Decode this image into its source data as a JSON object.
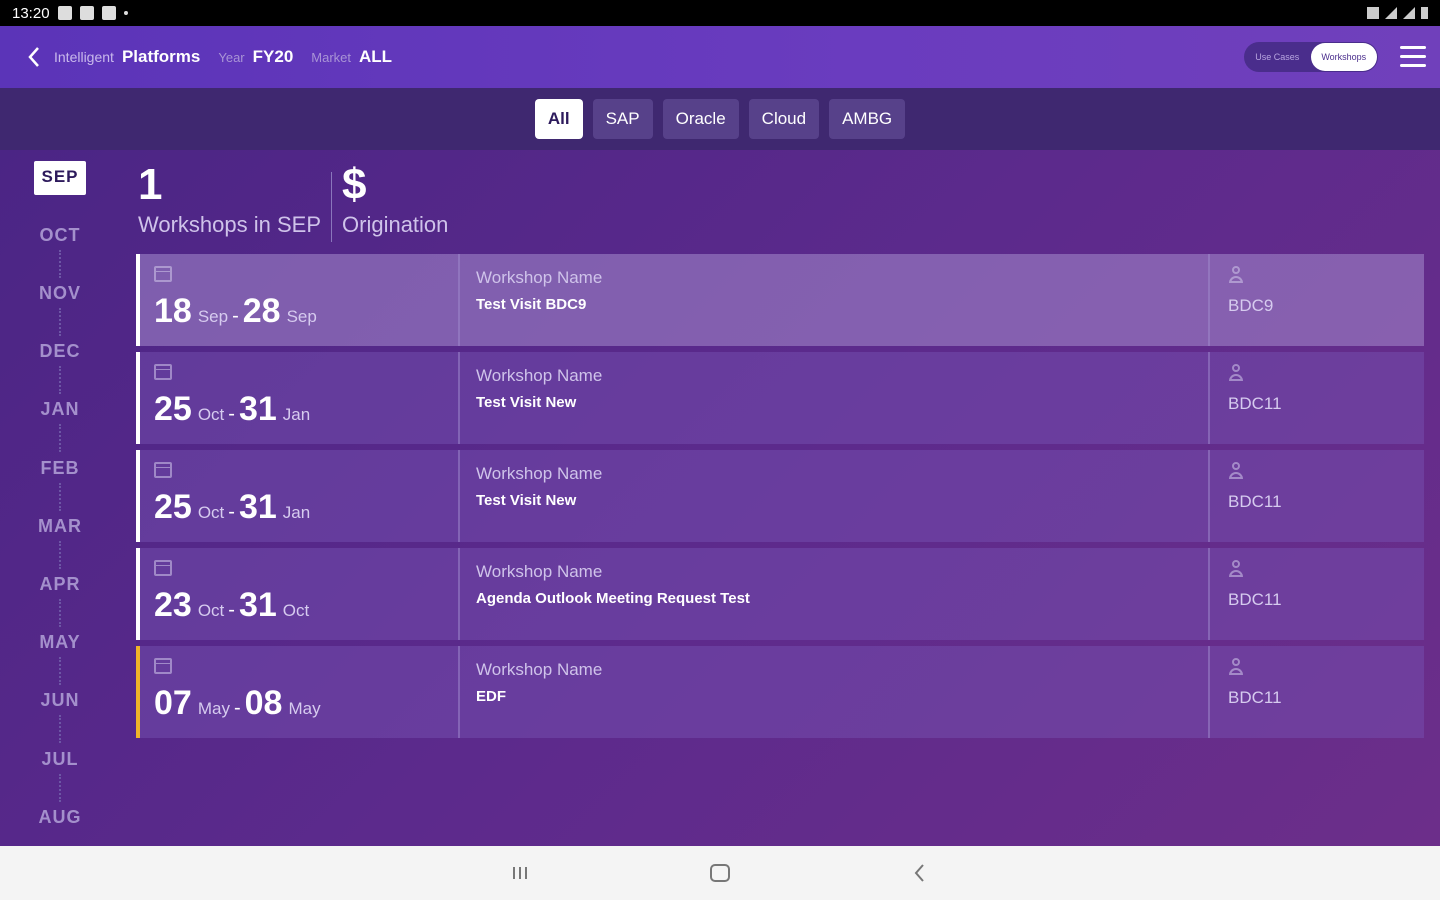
{
  "status_bar": {
    "time": "13:20"
  },
  "header": {
    "app_name_prefix": "Intelligent",
    "app_name": "Platforms",
    "year_label": "Year",
    "year_value": "FY20",
    "market_label": "Market",
    "market_value": "ALL",
    "toggle": {
      "option_1": "Use Cases",
      "option_2": "Workshops",
      "active": "Workshops"
    }
  },
  "filters": [
    "All",
    "SAP",
    "Oracle",
    "Cloud",
    "AMBG"
  ],
  "active_filter": "All",
  "months": [
    "SEP",
    "OCT",
    "NOV",
    "DEC",
    "JAN",
    "FEB",
    "MAR",
    "APR",
    "MAY",
    "JUN",
    "JUL",
    "AUG"
  ],
  "active_month": "SEP",
  "summary": {
    "count": "1",
    "count_label": "Workshops in SEP",
    "currency_symbol": "$",
    "currency_label": "Origination"
  },
  "workshops": [
    {
      "start_day": "18",
      "start_mon": "Sep",
      "end_day": "28",
      "end_mon": "Sep",
      "name_label": "Workshop Name",
      "name": "Test Visit BDC9",
      "owner": "BDC9",
      "highlight": true,
      "accent": "white"
    },
    {
      "start_day": "25",
      "start_mon": "Oct",
      "end_day": "31",
      "end_mon": "Jan",
      "name_label": "Workshop Name",
      "name": "Test Visit New",
      "owner": "BDC11",
      "highlight": false,
      "accent": "white"
    },
    {
      "start_day": "25",
      "start_mon": "Oct",
      "end_day": "31",
      "end_mon": "Jan",
      "name_label": "Workshop Name",
      "name": "Test Visit New",
      "owner": "BDC11",
      "highlight": false,
      "accent": "white"
    },
    {
      "start_day": "23",
      "start_mon": "Oct",
      "end_day": "31",
      "end_mon": "Oct",
      "name_label": "Workshop Name",
      "name": "Agenda Outlook Meeting Request Test",
      "owner": "BDC11",
      "highlight": false,
      "accent": "white"
    },
    {
      "start_day": "07",
      "start_mon": "May",
      "end_day": "08",
      "end_mon": "May",
      "name_label": "Workshop Name",
      "name": "EDF",
      "owner": "BDC11",
      "highlight": false,
      "accent": "yellow"
    }
  ],
  "colors": {
    "header": "#6a3cbf",
    "background": "#4b2585",
    "accent_yellow": "#f0b429"
  }
}
